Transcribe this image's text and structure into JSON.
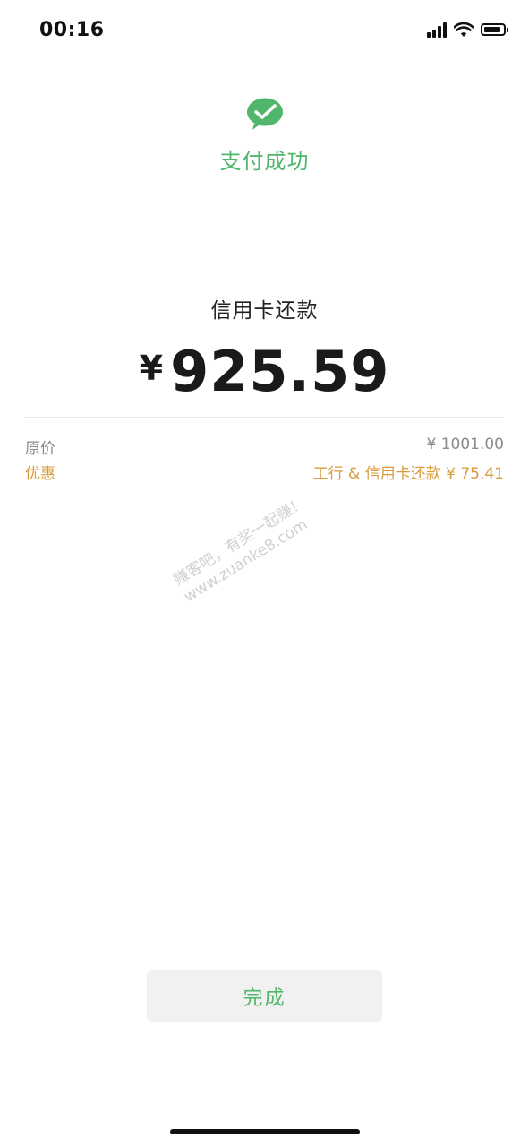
{
  "status_bar": {
    "time": "00:16"
  },
  "header": {
    "icon": "wechat-pay-icon",
    "title": "支付成功",
    "accent_color": "#4fb66b"
  },
  "payment": {
    "payee": "信用卡还款",
    "currency_symbol": "¥",
    "amount": "925.59"
  },
  "details": {
    "original_label": "原价",
    "original_value": "¥ 1001.00",
    "discount_label": "优惠",
    "discount_value": "工行 & 信用卡还款 ¥ 75.41",
    "discount_color": "#d99a3a"
  },
  "watermark": {
    "line1": "赚客吧，有奖一起赚！",
    "line2": "www.zuanke8.com"
  },
  "actions": {
    "done_label": "完成"
  }
}
